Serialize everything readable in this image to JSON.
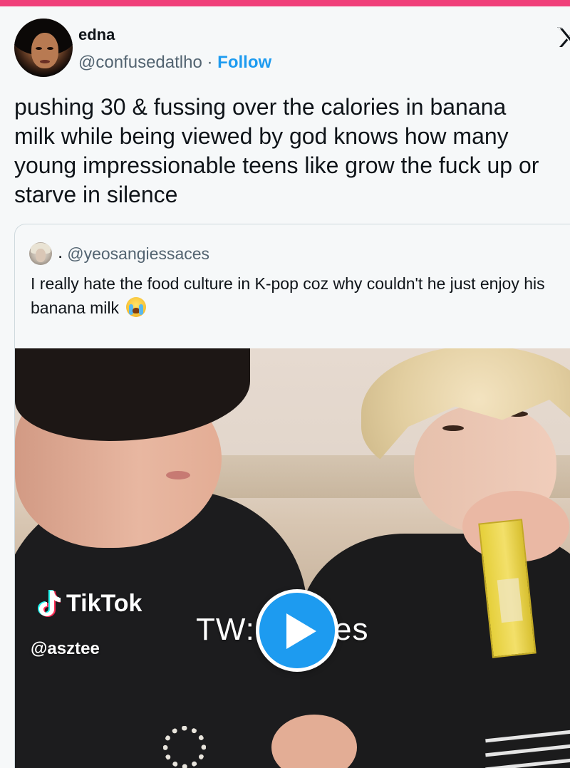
{
  "tweet": {
    "author": {
      "name": "edna",
      "handle": "@confusedatlho",
      "separator": "·",
      "follow_label": "Follow"
    },
    "logo_icon": "x-logo-icon",
    "text": "pushing 30 & fussing over the calories in banana\nmilk while being viewed by god knows how many\nyoung impressionable teens like grow the fuck up or\nstarve in silence"
  },
  "quoted": {
    "display_name": ".",
    "handle": "@yeosangiessaces",
    "text": "I really hate the food culture in K-pop coz why couldn't he just enjoy his banana milk",
    "emoji": "loudly-crying-face-icon",
    "media": {
      "type": "video",
      "watermark_brand": "TikTok",
      "watermark_user": "@asztee",
      "caption_overlay": "TW:calories",
      "play_icon": "play-icon"
    }
  },
  "colors": {
    "top_bar": "#f0407a",
    "follow": "#1d9bf0",
    "play_button": "#1d9bf0",
    "text_primary": "#0f1419",
    "text_secondary": "#536471",
    "quote_border": "#cfd9de"
  }
}
